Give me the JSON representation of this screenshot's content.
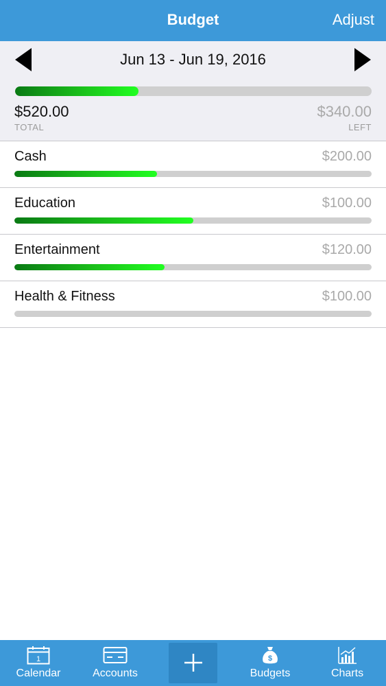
{
  "nav": {
    "title": "Budget",
    "adjust_label": "Adjust"
  },
  "summary": {
    "date_range": "Jun 13 - Jun 19, 2016",
    "progress": 0.346,
    "total_amount": "$520.00",
    "total_label": "TOTAL",
    "left_amount": "$340.00",
    "left_label": "LEFT"
  },
  "categories": [
    {
      "name": "Cash",
      "amount": "$200.00",
      "progress": 0.4
    },
    {
      "name": "Education",
      "amount": "$100.00",
      "progress": 0.5
    },
    {
      "name": "Entertainment",
      "amount": "$120.00",
      "progress": 0.42
    },
    {
      "name": "Health & Fitness",
      "amount": "$100.00",
      "progress": 0.0
    }
  ],
  "tabs": {
    "calendar": {
      "label": "Calendar",
      "icon": "calendar-icon",
      "day": "1"
    },
    "accounts": {
      "label": "Accounts",
      "icon": "credit-card-icon"
    },
    "add": {
      "icon": "plus-icon"
    },
    "budgets": {
      "label": "Budgets",
      "icon": "money-bag-icon"
    },
    "charts": {
      "label": "Charts",
      "icon": "bar-chart-icon"
    }
  },
  "colors": {
    "bar_blue": "#3d99d9",
    "progress_dark": "#0a7a14",
    "progress_light": "#21ff21",
    "track_gray": "#cfcfcf"
  }
}
